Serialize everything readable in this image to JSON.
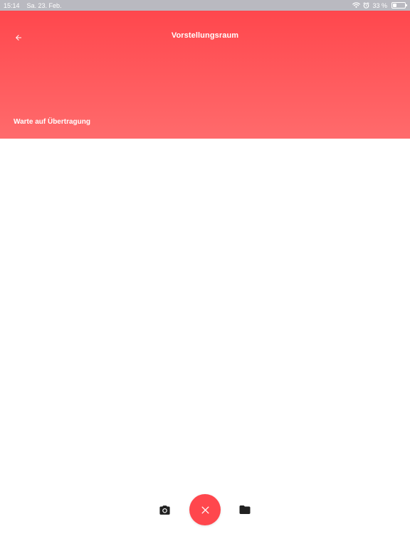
{
  "status_bar": {
    "time": "15:14",
    "date": "Sa. 23. Feb.",
    "battery_text": "33 %",
    "battery_level": 0.33,
    "icons": [
      "wifi-icon",
      "alarm-icon",
      "battery-icon"
    ]
  },
  "header": {
    "title": "Vorstellungsraum",
    "back_icon": "arrow-left-icon",
    "status_message": "Warte auf Übertragung"
  },
  "bottom_bar": {
    "camera_icon": "camera-icon",
    "close_icon": "close-icon",
    "folder_icon": "folder-icon"
  },
  "colors": {
    "accent": "#ff474d",
    "accent_light": "#ff6b6c",
    "status_bar": "#b9b9c0",
    "icon_dark": "#212121"
  }
}
